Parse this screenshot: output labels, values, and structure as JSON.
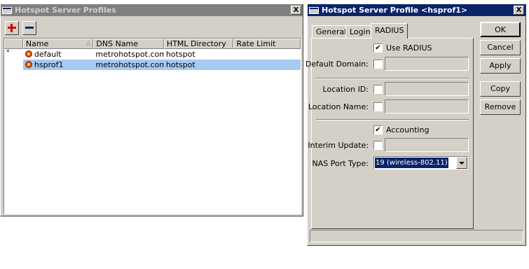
{
  "profiles_window": {
    "title": "Hotspot Server Profiles",
    "close_label": "X",
    "columns": [
      "Name",
      "DNS Name",
      "HTML Directory",
      "Rate Limit"
    ],
    "sort_indicator": "△",
    "rows": [
      {
        "marker": "*",
        "name": "default",
        "dns": "metrohotspot.com",
        "html_dir": "hotspot",
        "rate_limit": ""
      },
      {
        "marker": "",
        "name": "hsprof1",
        "dns": "metrohotspot.com",
        "html_dir": "hotspot",
        "rate_limit": ""
      }
    ],
    "toolbar": {
      "add_icon": "plus-icon",
      "remove_icon": "minus-icon"
    }
  },
  "profile_window": {
    "title": "Hotspot Server Profile <hsprof1>",
    "close_label": "X",
    "tabs": [
      "General",
      "Login",
      "RADIUS"
    ],
    "active_tab": "RADIUS",
    "use_radius": {
      "label": "Use RADIUS",
      "checked": true
    },
    "default_domain": {
      "label": "Default Domain:",
      "checked": false,
      "value": ""
    },
    "location_id": {
      "label": "Location ID:",
      "checked": false,
      "value": ""
    },
    "location_name": {
      "label": "Location Name:",
      "checked": false,
      "value": ""
    },
    "accounting": {
      "label": "Accounting",
      "checked": true
    },
    "interim_update": {
      "label": "Interim Update:",
      "checked": false,
      "value": ""
    },
    "nas_port_type": {
      "label": "NAS Port Type:",
      "value": "19 (wireless-802.11)"
    },
    "buttons": {
      "ok": "OK",
      "cancel": "Cancel",
      "apply": "Apply",
      "copy": "Copy",
      "remove": "Remove"
    }
  },
  "colors": {
    "active_title": "#0a246a",
    "inactive_title": "#808080",
    "selection": "#a6caf0",
    "face": "#d4d0c8"
  }
}
